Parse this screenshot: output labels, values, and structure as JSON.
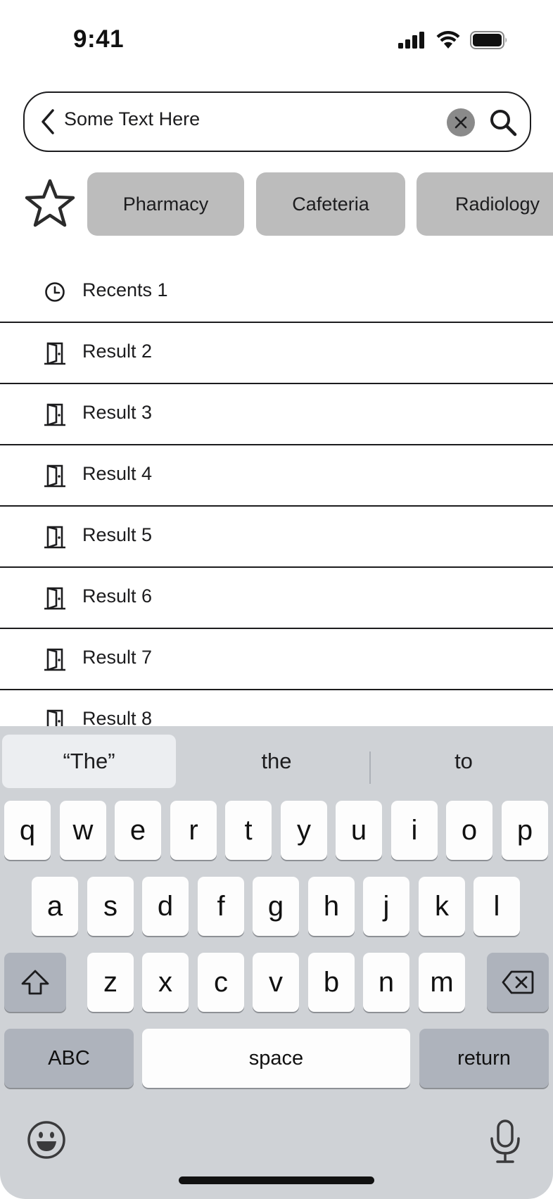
{
  "status_bar": {
    "time": "9:41"
  },
  "search": {
    "value": "Some Text Here"
  },
  "chips": [
    "Pharmacy",
    "Cafeteria",
    "Radiology"
  ],
  "results": [
    {
      "label": "Recents 1",
      "icon": "clock-icon"
    },
    {
      "label": "Result 2",
      "icon": "door-icon"
    },
    {
      "label": "Result 3",
      "icon": "door-icon"
    },
    {
      "label": "Result 4",
      "icon": "door-icon"
    },
    {
      "label": "Result 5",
      "icon": "door-icon"
    },
    {
      "label": "Result 6",
      "icon": "door-icon"
    },
    {
      "label": "Result 7",
      "icon": "door-icon"
    },
    {
      "label": "Result 8",
      "icon": "door-icon"
    }
  ],
  "keyboard": {
    "suggestions": [
      "“The”",
      "the",
      "to"
    ],
    "row1": [
      "q",
      "w",
      "e",
      "r",
      "t",
      "y",
      "u",
      "i",
      "o",
      "p"
    ],
    "row2": [
      "a",
      "s",
      "d",
      "f",
      "g",
      "h",
      "j",
      "k",
      "l"
    ],
    "row3": [
      "z",
      "x",
      "c",
      "v",
      "b",
      "n",
      "m"
    ],
    "abc_label": "ABC",
    "space_label": "space",
    "return_label": "return"
  },
  "colors": {
    "chip_bg": "#bcbcbc",
    "keyboard_bg": "#cfd2d6",
    "clear_button": "#8a8a8a"
  }
}
